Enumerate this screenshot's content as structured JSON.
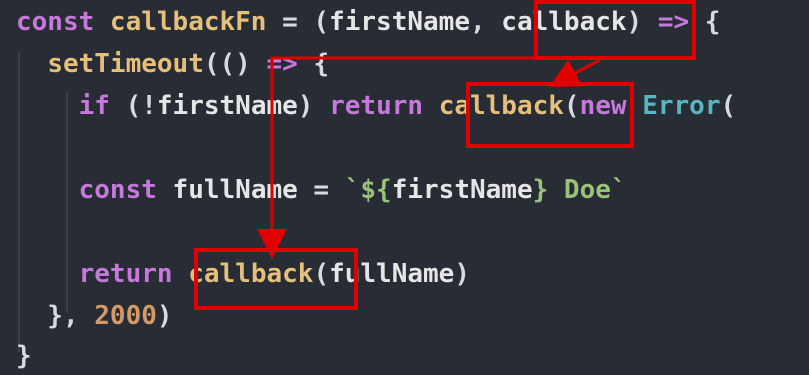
{
  "code": {
    "lines": [
      {
        "tokens": [
          {
            "text": "const ",
            "cls": "kw"
          },
          {
            "text": "callbackFn",
            "cls": "gold"
          },
          {
            "text": " = (",
            "cls": "punc"
          },
          {
            "text": "firstName",
            "cls": "pln"
          },
          {
            "text": ", ",
            "cls": "punc"
          },
          {
            "text": "callback",
            "cls": "pln"
          },
          {
            "text": ") ",
            "cls": "punc"
          },
          {
            "text": "=>",
            "cls": "kw"
          },
          {
            "text": " {",
            "cls": "punc"
          }
        ]
      },
      {
        "tokens": [
          {
            "text": "  ",
            "cls": "punc"
          },
          {
            "text": "setTimeout",
            "cls": "gold"
          },
          {
            "text": "(() ",
            "cls": "punc"
          },
          {
            "text": "=>",
            "cls": "kw"
          },
          {
            "text": " {",
            "cls": "punc"
          }
        ]
      },
      {
        "tokens": [
          {
            "text": "    ",
            "cls": "punc"
          },
          {
            "text": "if",
            "cls": "kw"
          },
          {
            "text": " (!",
            "cls": "punc"
          },
          {
            "text": "firstName",
            "cls": "pln"
          },
          {
            "text": ") ",
            "cls": "punc"
          },
          {
            "text": "return",
            "cls": "kw"
          },
          {
            "text": " ",
            "cls": "punc"
          },
          {
            "text": "callback",
            "cls": "gold"
          },
          {
            "text": "(",
            "cls": "punc"
          },
          {
            "text": "new",
            "cls": "kw"
          },
          {
            "text": " ",
            "cls": "punc"
          },
          {
            "text": "Error",
            "cls": "cyan"
          },
          {
            "text": "(",
            "cls": "punc"
          }
        ]
      },
      {
        "tokens": []
      },
      {
        "tokens": [
          {
            "text": "    ",
            "cls": "punc"
          },
          {
            "text": "const ",
            "cls": "kw"
          },
          {
            "text": "fullName",
            "cls": "pln"
          },
          {
            "text": " = ",
            "cls": "punc"
          },
          {
            "text": "`${",
            "cls": "str"
          },
          {
            "text": "firstName",
            "cls": "pln"
          },
          {
            "text": "} Doe`",
            "cls": "str"
          }
        ]
      },
      {
        "tokens": []
      },
      {
        "tokens": [
          {
            "text": "    ",
            "cls": "punc"
          },
          {
            "text": "return",
            "cls": "kw"
          },
          {
            "text": " ",
            "cls": "punc"
          },
          {
            "text": "callback",
            "cls": "gold"
          },
          {
            "text": "(",
            "cls": "punc"
          },
          {
            "text": "fullName",
            "cls": "pln"
          },
          {
            "text": ")",
            "cls": "punc"
          }
        ]
      },
      {
        "tokens": [
          {
            "text": "  }, ",
            "cls": "punc"
          },
          {
            "text": "2000",
            "cls": "num"
          },
          {
            "text": ")",
            "cls": "punc"
          }
        ]
      },
      {
        "tokens": [
          {
            "text": "}",
            "cls": "punc"
          }
        ]
      }
    ]
  },
  "annotation": {
    "color": "#e00000"
  }
}
